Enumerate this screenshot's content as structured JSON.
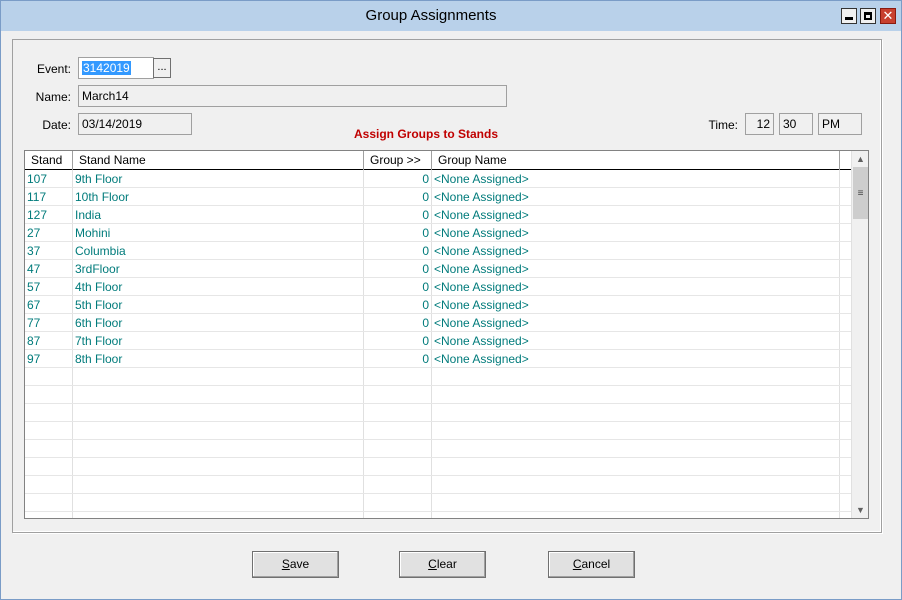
{
  "window": {
    "title": "Group Assignments"
  },
  "form": {
    "event_label": "Event:",
    "event_value": "3142019",
    "browse_label": "...",
    "name_label": "Name:",
    "name_value": "March14",
    "date_label": "Date:",
    "date_value": "03/14/2019",
    "time_label": "Time:",
    "time_hour": "12",
    "time_minute": "30",
    "time_ampm": "PM",
    "heading": "Assign Groups to Stands"
  },
  "grid": {
    "columns": [
      "Stand",
      "Stand Name",
      "Group >>",
      "Group Name"
    ],
    "rows": [
      {
        "stand": "107",
        "name": "9th Floor",
        "group": "0",
        "group_name": "<None Assigned>"
      },
      {
        "stand": "117",
        "name": "10th Floor",
        "group": "0",
        "group_name": "<None Assigned>"
      },
      {
        "stand": "127",
        "name": "India",
        "group": "0",
        "group_name": "<None Assigned>"
      },
      {
        "stand": "27",
        "name": "Mohini",
        "group": "0",
        "group_name": "<None Assigned>"
      },
      {
        "stand": "37",
        "name": "Columbia",
        "group": "0",
        "group_name": "<None Assigned>"
      },
      {
        "stand": "47",
        "name": "3rdFloor",
        "group": "0",
        "group_name": "<None Assigned>"
      },
      {
        "stand": "57",
        "name": "4th Floor",
        "group": "0",
        "group_name": "<None Assigned>"
      },
      {
        "stand": "67",
        "name": "5th Floor",
        "group": "0",
        "group_name": "<None Assigned>"
      },
      {
        "stand": "77",
        "name": "6th Floor",
        "group": "0",
        "group_name": "<None Assigned>"
      },
      {
        "stand": "87",
        "name": "7th Floor",
        "group": "0",
        "group_name": "<None Assigned>"
      },
      {
        "stand": "97",
        "name": "8th Floor",
        "group": "0",
        "group_name": "<None Assigned>"
      }
    ]
  },
  "buttons": {
    "save_ul": "S",
    "save_rest": "ave",
    "clear_ul": "C",
    "clear_rest": "lear",
    "cancel_ul": "C",
    "cancel_rest": "ancel"
  },
  "colors": {
    "titlebar": "#b9d1ea",
    "heading": "#c00000",
    "row_text": "#007b7b",
    "selection": "#3399ff"
  }
}
